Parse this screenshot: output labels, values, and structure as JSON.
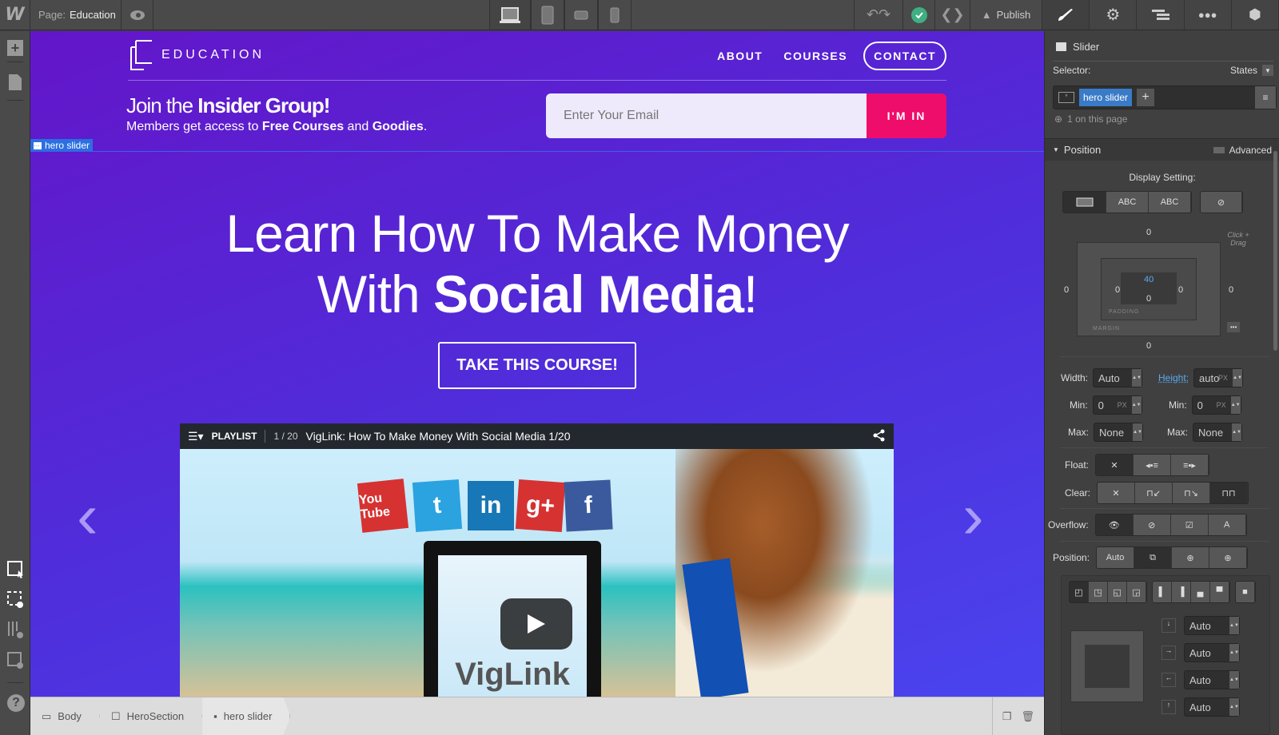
{
  "topbar": {
    "logo": "W",
    "page_label": "Page:",
    "page_name": "Education",
    "publish_label": "Publish",
    "devices": [
      "desktop-icon",
      "tablet-icon",
      "phone-landscape-icon",
      "phone-portrait-icon"
    ]
  },
  "site": {
    "brand": "EDUCATION",
    "nav": [
      "ABOUT",
      "COURSES",
      "CONTACT"
    ],
    "insider_light": "Join the ",
    "insider_bold": "Insider Group!",
    "members_a": "Members get access to ",
    "members_b": "Free Courses",
    "members_c": " and ",
    "members_d": "Goodies",
    "members_e": ".",
    "email_placeholder": "Enter Your Email",
    "im_in": "I'M IN",
    "selection_badge": "hero slider",
    "headline_line1": "Learn How To Make Money",
    "headline_with": "With ",
    "headline_bold": "Social Media",
    "headline_end": "!",
    "cta": "TAKE THIS COURSE!",
    "prev_arrow": "‹",
    "next_arrow": "›",
    "video": {
      "playlist": "PLAYLIST",
      "count": "1 / 20",
      "title": "VigLink: How To Make Money With Social Media 1/20",
      "laptop_text": "VigLink",
      "social_icons": [
        "You Tube",
        "t",
        "in",
        "g+",
        "f"
      ]
    }
  },
  "breadcrumbs": [
    "Body",
    "HeroSection",
    "hero slider"
  ],
  "panel": {
    "element_type": "Slider",
    "selector_label": "Selector:",
    "states_label": "States",
    "selector_class": "hero slider",
    "on_page": "1 on this page",
    "section": "Position",
    "advanced": "Advanced",
    "display_setting": "Display Setting:",
    "display_options": [
      "block",
      "ABC",
      "ABC",
      "none"
    ],
    "box": {
      "margin_top": "0",
      "margin_right": "0",
      "margin_bottom": "0",
      "margin_left": "0",
      "padding_top": "40",
      "padding_right": "0",
      "padding_bottom": "0",
      "padding_left": "0",
      "padding_label": "PADDING",
      "margin_label": "MARGIN",
      "hint": "Click + Drag"
    },
    "width_label": "Width:",
    "width_value": "Auto",
    "height_label": "Height:",
    "height_value": "auto",
    "unit": "PX",
    "min_label": "Min:",
    "min_w": "0",
    "min_h": "0",
    "max_label": "Max:",
    "max_w": "None",
    "max_h": "None",
    "float_label": "Float:",
    "clear_label": "Clear:",
    "overflow_label": "Overflow:",
    "position_label": "Position:",
    "position_auto": "Auto",
    "offsets": [
      "Auto",
      "Auto",
      "Auto",
      "Auto"
    ]
  }
}
